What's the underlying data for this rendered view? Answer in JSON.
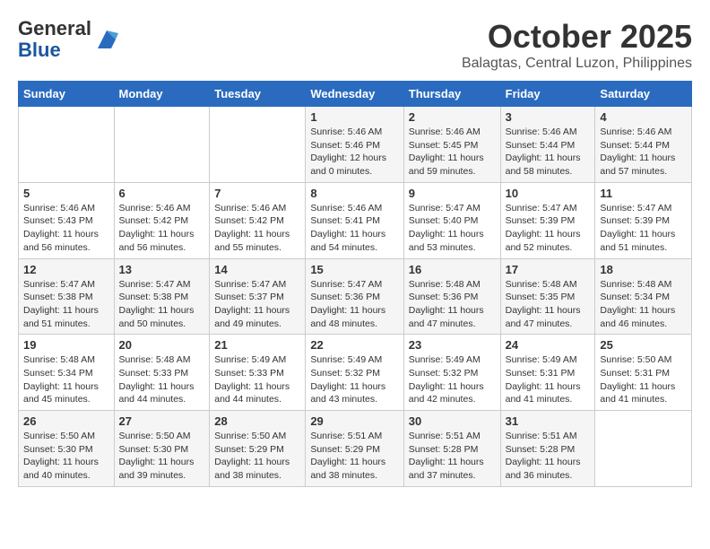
{
  "header": {
    "logo_general": "General",
    "logo_blue": "Blue",
    "month_title": "October 2025",
    "location": "Balagtas, Central Luzon, Philippines"
  },
  "days_of_week": [
    "Sunday",
    "Monday",
    "Tuesday",
    "Wednesday",
    "Thursday",
    "Friday",
    "Saturday"
  ],
  "weeks": [
    [
      {
        "day": "",
        "detail": ""
      },
      {
        "day": "",
        "detail": ""
      },
      {
        "day": "",
        "detail": ""
      },
      {
        "day": "1",
        "detail": "Sunrise: 5:46 AM\nSunset: 5:46 PM\nDaylight: 12 hours\nand 0 minutes."
      },
      {
        "day": "2",
        "detail": "Sunrise: 5:46 AM\nSunset: 5:45 PM\nDaylight: 11 hours\nand 59 minutes."
      },
      {
        "day": "3",
        "detail": "Sunrise: 5:46 AM\nSunset: 5:44 PM\nDaylight: 11 hours\nand 58 minutes."
      },
      {
        "day": "4",
        "detail": "Sunrise: 5:46 AM\nSunset: 5:44 PM\nDaylight: 11 hours\nand 57 minutes."
      }
    ],
    [
      {
        "day": "5",
        "detail": "Sunrise: 5:46 AM\nSunset: 5:43 PM\nDaylight: 11 hours\nand 56 minutes."
      },
      {
        "day": "6",
        "detail": "Sunrise: 5:46 AM\nSunset: 5:42 PM\nDaylight: 11 hours\nand 56 minutes."
      },
      {
        "day": "7",
        "detail": "Sunrise: 5:46 AM\nSunset: 5:42 PM\nDaylight: 11 hours\nand 55 minutes."
      },
      {
        "day": "8",
        "detail": "Sunrise: 5:46 AM\nSunset: 5:41 PM\nDaylight: 11 hours\nand 54 minutes."
      },
      {
        "day": "9",
        "detail": "Sunrise: 5:47 AM\nSunset: 5:40 PM\nDaylight: 11 hours\nand 53 minutes."
      },
      {
        "day": "10",
        "detail": "Sunrise: 5:47 AM\nSunset: 5:39 PM\nDaylight: 11 hours\nand 52 minutes."
      },
      {
        "day": "11",
        "detail": "Sunrise: 5:47 AM\nSunset: 5:39 PM\nDaylight: 11 hours\nand 51 minutes."
      }
    ],
    [
      {
        "day": "12",
        "detail": "Sunrise: 5:47 AM\nSunset: 5:38 PM\nDaylight: 11 hours\nand 51 minutes."
      },
      {
        "day": "13",
        "detail": "Sunrise: 5:47 AM\nSunset: 5:38 PM\nDaylight: 11 hours\nand 50 minutes."
      },
      {
        "day": "14",
        "detail": "Sunrise: 5:47 AM\nSunset: 5:37 PM\nDaylight: 11 hours\nand 49 minutes."
      },
      {
        "day": "15",
        "detail": "Sunrise: 5:47 AM\nSunset: 5:36 PM\nDaylight: 11 hours\nand 48 minutes."
      },
      {
        "day": "16",
        "detail": "Sunrise: 5:48 AM\nSunset: 5:36 PM\nDaylight: 11 hours\nand 47 minutes."
      },
      {
        "day": "17",
        "detail": "Sunrise: 5:48 AM\nSunset: 5:35 PM\nDaylight: 11 hours\nand 47 minutes."
      },
      {
        "day": "18",
        "detail": "Sunrise: 5:48 AM\nSunset: 5:34 PM\nDaylight: 11 hours\nand 46 minutes."
      }
    ],
    [
      {
        "day": "19",
        "detail": "Sunrise: 5:48 AM\nSunset: 5:34 PM\nDaylight: 11 hours\nand 45 minutes."
      },
      {
        "day": "20",
        "detail": "Sunrise: 5:48 AM\nSunset: 5:33 PM\nDaylight: 11 hours\nand 44 minutes."
      },
      {
        "day": "21",
        "detail": "Sunrise: 5:49 AM\nSunset: 5:33 PM\nDaylight: 11 hours\nand 44 minutes."
      },
      {
        "day": "22",
        "detail": "Sunrise: 5:49 AM\nSunset: 5:32 PM\nDaylight: 11 hours\nand 43 minutes."
      },
      {
        "day": "23",
        "detail": "Sunrise: 5:49 AM\nSunset: 5:32 PM\nDaylight: 11 hours\nand 42 minutes."
      },
      {
        "day": "24",
        "detail": "Sunrise: 5:49 AM\nSunset: 5:31 PM\nDaylight: 11 hours\nand 41 minutes."
      },
      {
        "day": "25",
        "detail": "Sunrise: 5:50 AM\nSunset: 5:31 PM\nDaylight: 11 hours\nand 41 minutes."
      }
    ],
    [
      {
        "day": "26",
        "detail": "Sunrise: 5:50 AM\nSunset: 5:30 PM\nDaylight: 11 hours\nand 40 minutes."
      },
      {
        "day": "27",
        "detail": "Sunrise: 5:50 AM\nSunset: 5:30 PM\nDaylight: 11 hours\nand 39 minutes."
      },
      {
        "day": "28",
        "detail": "Sunrise: 5:50 AM\nSunset: 5:29 PM\nDaylight: 11 hours\nand 38 minutes."
      },
      {
        "day": "29",
        "detail": "Sunrise: 5:51 AM\nSunset: 5:29 PM\nDaylight: 11 hours\nand 38 minutes."
      },
      {
        "day": "30",
        "detail": "Sunrise: 5:51 AM\nSunset: 5:28 PM\nDaylight: 11 hours\nand 37 minutes."
      },
      {
        "day": "31",
        "detail": "Sunrise: 5:51 AM\nSunset: 5:28 PM\nDaylight: 11 hours\nand 36 minutes."
      },
      {
        "day": "",
        "detail": ""
      }
    ]
  ]
}
